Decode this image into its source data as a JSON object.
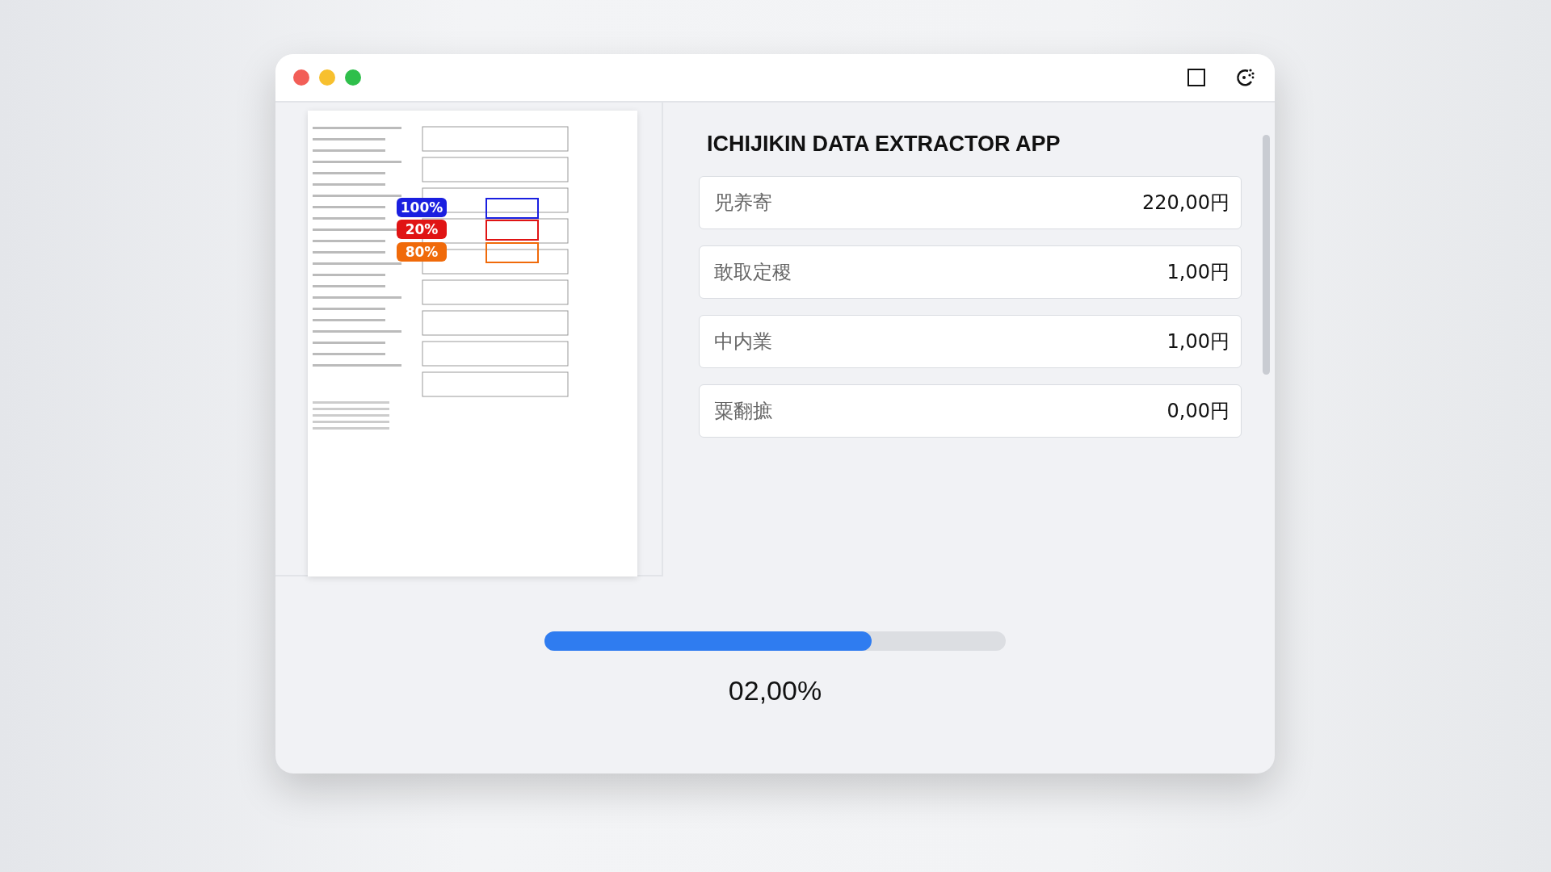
{
  "window": {
    "title_bar": {
      "buttons": [
        {
          "kind": "close"
        },
        {
          "kind": "minimize"
        },
        {
          "kind": "maximize"
        }
      ],
      "tools": [
        {
          "kind": "square"
        },
        {
          "kind": "scan"
        }
      ]
    }
  },
  "document": {
    "badges": [
      {
        "label": "100%",
        "color": "#1a1fe0"
      },
      {
        "label": "20%",
        "color": "#e01414"
      },
      {
        "label": "80%",
        "color": "#f06a0a"
      }
    ]
  },
  "app": {
    "title": "ICHIJIKIN DATA EXTRACTOR APP",
    "fields": [
      {
        "label": "兕养寄",
        "value": "220,00円"
      },
      {
        "label": "敢取定稷",
        "value": "1,00円"
      },
      {
        "label": "中内業",
        "value": "1,00円"
      },
      {
        "label": "粟翻摭",
        "value": "0,00円"
      }
    ]
  },
  "progress": {
    "level": 0.71,
    "reading": "02,00%"
  }
}
